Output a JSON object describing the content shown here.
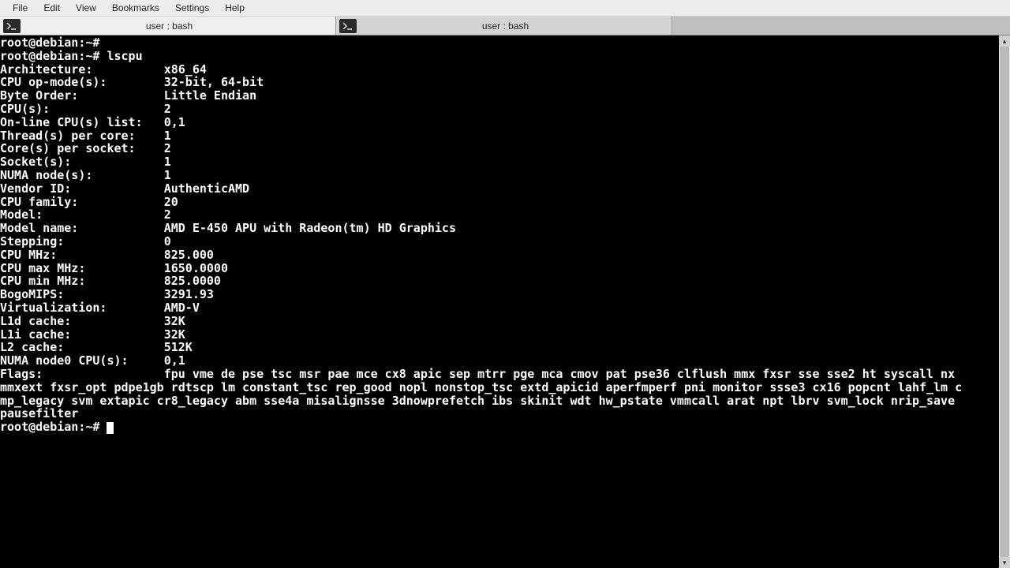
{
  "menubar": {
    "items": [
      {
        "label": "File"
      },
      {
        "label": "Edit"
      },
      {
        "label": "View"
      },
      {
        "label": "Bookmarks"
      },
      {
        "label": "Settings"
      },
      {
        "label": "Help"
      }
    ]
  },
  "tabs": [
    {
      "label": "user : bash",
      "active": true
    },
    {
      "label": "user : bash",
      "active": false
    }
  ],
  "prompt": "root@debian:~#",
  "command": "lscpu",
  "lscpu_rows": [
    {
      "k": "Architecture:",
      "v": "x86_64"
    },
    {
      "k": "CPU op-mode(s):",
      "v": "32-bit, 64-bit"
    },
    {
      "k": "Byte Order:",
      "v": "Little Endian"
    },
    {
      "k": "CPU(s):",
      "v": "2"
    },
    {
      "k": "On-line CPU(s) list:",
      "v": "0,1"
    },
    {
      "k": "Thread(s) per core:",
      "v": "1"
    },
    {
      "k": "Core(s) per socket:",
      "v": "2"
    },
    {
      "k": "Socket(s):",
      "v": "1"
    },
    {
      "k": "NUMA node(s):",
      "v": "1"
    },
    {
      "k": "Vendor ID:",
      "v": "AuthenticAMD"
    },
    {
      "k": "CPU family:",
      "v": "20"
    },
    {
      "k": "Model:",
      "v": "2"
    },
    {
      "k": "Model name:",
      "v": "AMD E-450 APU with Radeon(tm) HD Graphics"
    },
    {
      "k": "Stepping:",
      "v": "0"
    },
    {
      "k": "CPU MHz:",
      "v": "825.000"
    },
    {
      "k": "CPU max MHz:",
      "v": "1650.0000"
    },
    {
      "k": "CPU min MHz:",
      "v": "825.0000"
    },
    {
      "k": "BogoMIPS:",
      "v": "3291.93"
    },
    {
      "k": "Virtualization:",
      "v": "AMD-V"
    },
    {
      "k": "L1d cache:",
      "v": "32K"
    },
    {
      "k": "L1i cache:",
      "v": "32K"
    },
    {
      "k": "L2 cache:",
      "v": "512K"
    },
    {
      "k": "NUMA node0 CPU(s):",
      "v": "0,1"
    }
  ],
  "flags_label": "Flags:",
  "flags_lines": [
    "fpu vme de pse tsc msr pae mce cx8 apic sep mtrr pge mca cmov pat pse36 clflush mmx fxsr sse sse2 ht syscall nx",
    "mmxext fxsr_opt pdpe1gb rdtscp lm constant_tsc rep_good nopl nonstop_tsc extd_apicid aperfmperf pni monitor ssse3 cx16 popcnt lahf_lm c",
    "mp_legacy svm extapic cr8_legacy abm sse4a misalignsse 3dnowprefetch ibs skinit wdt hw_pstate vmmcall arat npt lbrv svm_lock nrip_save",
    "pausefilter"
  ],
  "key_col_width": 23
}
